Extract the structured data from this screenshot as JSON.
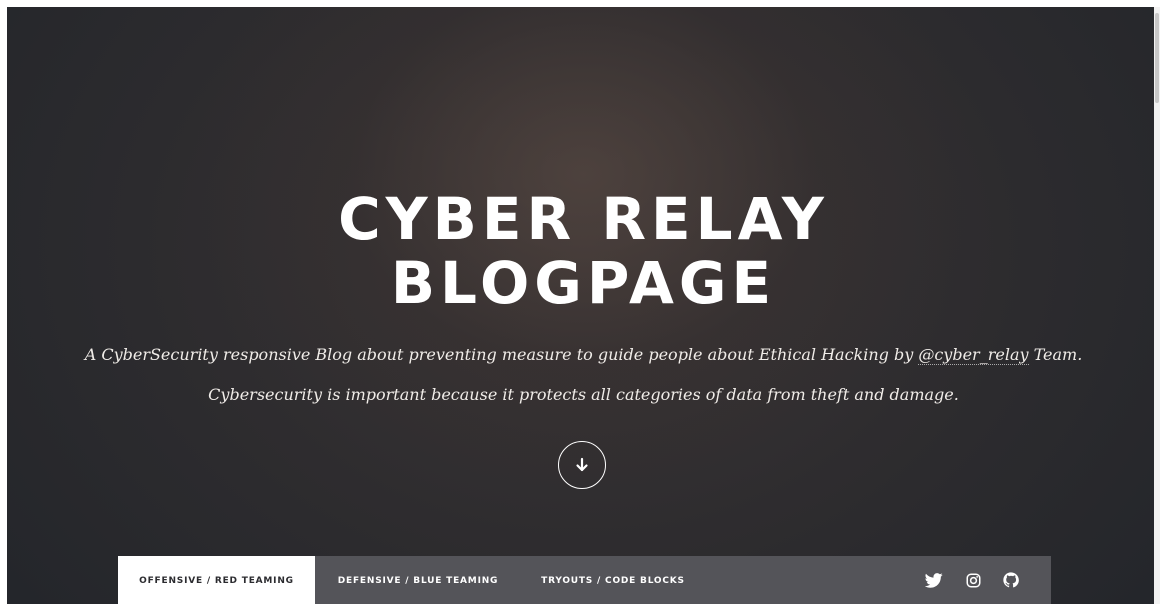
{
  "hero": {
    "title_line1": "CYBER RELAY",
    "title_line2": "BLOGPAGE",
    "tagline_line1_prefix": "A CyberSecurity responsive Blog about preventing measure to guide people about Ethical Hacking by ",
    "tagline_handle": "@cyber_relay",
    "tagline_line1_suffix": " Team.",
    "tagline_line2": "Cybersecurity is important because it protects all categories of data from theft and damage."
  },
  "nav": {
    "tabs": [
      {
        "label": "OFFENSIVE / RED TEAMING",
        "active": true
      },
      {
        "label": "DEFENSIVE / BLUE TEAMING",
        "active": false
      },
      {
        "label": "TRYOUTS / CODE BLOCKS",
        "active": false
      }
    ],
    "social_icons": [
      "twitter-icon",
      "instagram-icon",
      "github-icon"
    ]
  },
  "colors": {
    "background_dark": "#2c2b2e",
    "nav_bar": "#545459",
    "active_tab": "#ffffff",
    "text": "#ffffff"
  }
}
